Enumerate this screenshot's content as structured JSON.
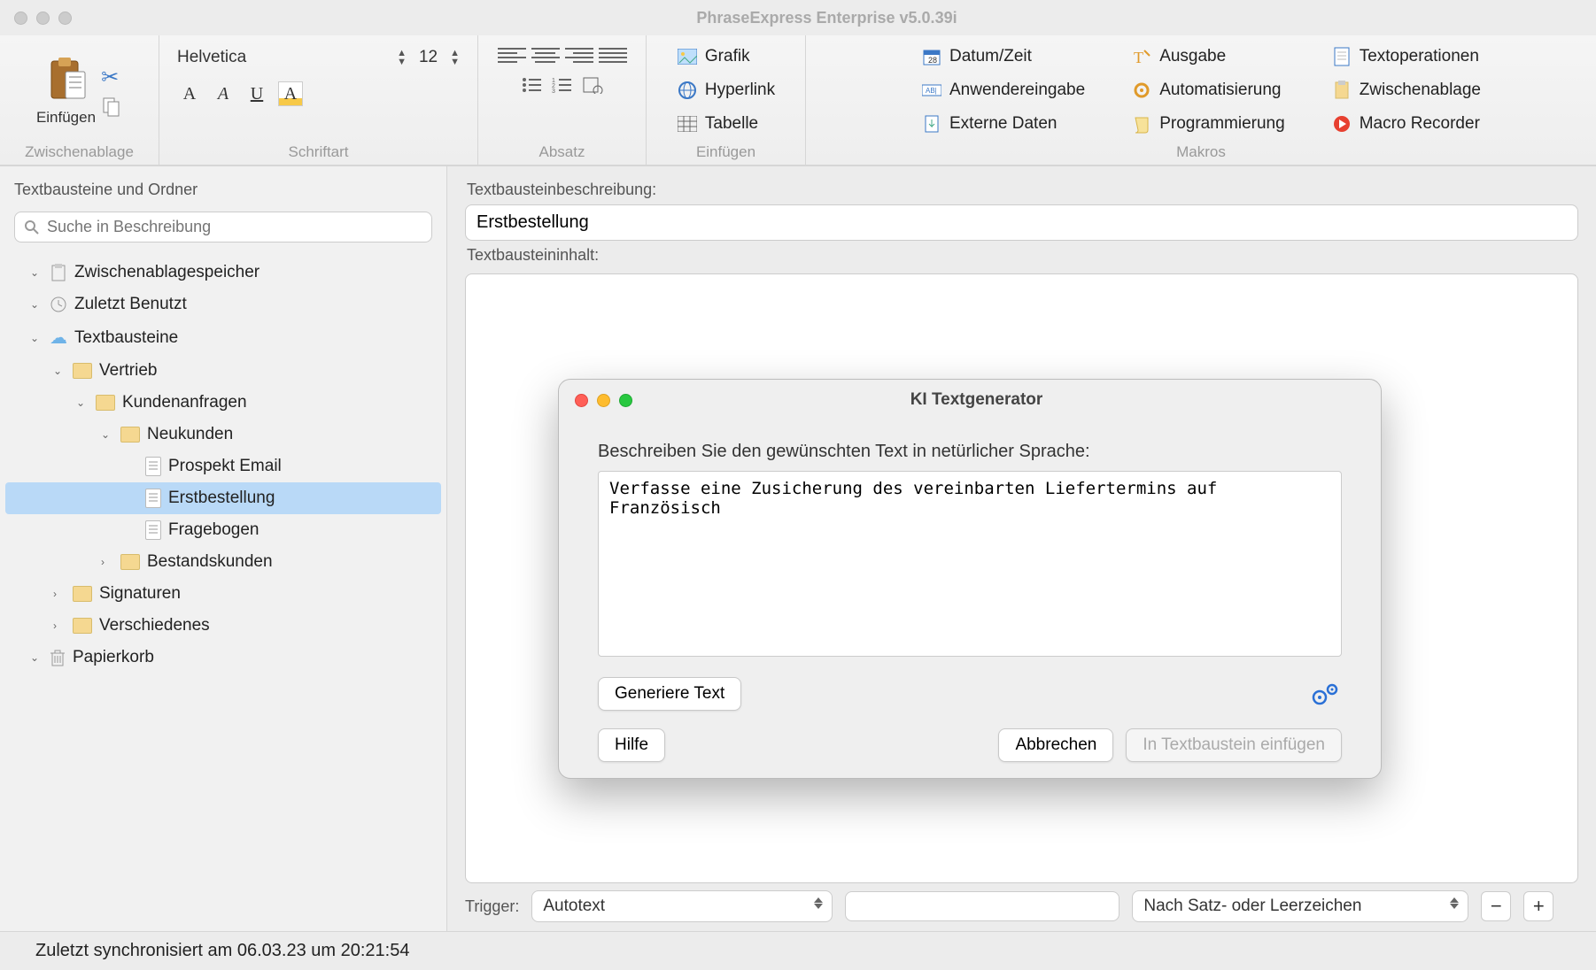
{
  "window": {
    "title": "PhraseExpress Enterprise v5.0.39i"
  },
  "ribbon": {
    "insert_label": "Einfügen",
    "groups": {
      "clipboard": "Zwischenablage",
      "font": "Schriftart",
      "paragraph": "Absatz",
      "insert": "Einfügen",
      "macros": "Makros"
    },
    "font_name": "Helvetica",
    "font_size": "12",
    "insert_items": {
      "graphic": "Grafik",
      "hyperlink": "Hyperlink",
      "table": "Tabelle"
    },
    "macro_items": {
      "datetime": "Datum/Zeit",
      "userinput": "Anwendereingabe",
      "externaldata": "Externe Daten",
      "output": "Ausgabe",
      "automation": "Automatisierung",
      "programming": "Programmierung",
      "textops": "Textoperationen",
      "clipboard": "Zwischenablage",
      "recorder": "Macro Recorder"
    }
  },
  "sidebar": {
    "title": "Textbausteine und Ordner",
    "search_placeholder": "Suche in Beschreibung",
    "items": {
      "clip": "Zwischenablagespeicher",
      "recent": "Zuletzt Benutzt",
      "phrases": "Textbausteine",
      "sales": "Vertrieb",
      "inquiries": "Kundenanfragen",
      "newcust": "Neukunden",
      "prospect": "Prospekt Email",
      "firstorder": "Erstbestellung",
      "survey": "Fragebogen",
      "existing": "Bestandskunden",
      "signatures": "Signaturen",
      "misc": "Verschiedenes",
      "trash": "Papierkorb"
    }
  },
  "main": {
    "desc_label": "Textbausteinbeschreibung:",
    "desc_value": "Erstbestellung",
    "content_label": "Textbausteininhalt:",
    "trigger_label": "Trigger:",
    "trigger_select": "Autotext",
    "trigger_mode": "Nach Satz- oder Leerzeichen"
  },
  "dialog": {
    "title": "KI Textgenerator",
    "prompt_label": "Beschreiben Sie den gewünschten Text in netürlicher Sprache:",
    "prompt_value": "Verfasse eine Zusicherung des vereinbarten Liefertermins auf Französisch",
    "generate": "Generiere Text",
    "help": "Hilfe",
    "cancel": "Abbrechen",
    "insert": "In Textbaustein einfügen"
  },
  "status": "Zuletzt synchronisiert am 06.03.23 um 20:21:54"
}
